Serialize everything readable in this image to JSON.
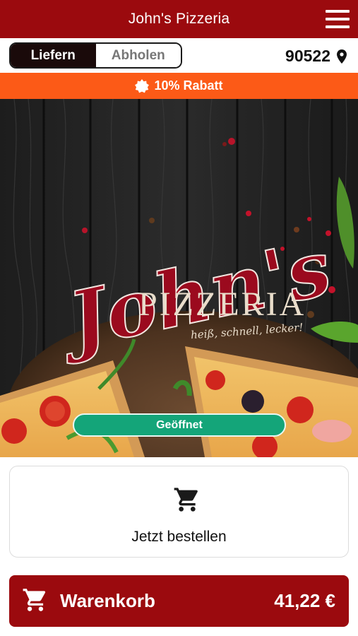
{
  "header": {
    "title": "John's Pizzeria",
    "menu_icon": "hamburger-menu-icon",
    "bg_color": "#9b0a0e"
  },
  "mode_toggle": {
    "options": [
      {
        "label": "Liefern",
        "active": true
      },
      {
        "label": "Abholen",
        "active": false
      }
    ]
  },
  "location": {
    "zip": "90522",
    "icon": "location-pin-icon"
  },
  "discount_banner": {
    "text": "10% Rabatt",
    "icon": "badge-icon",
    "bg_color": "#fc5a17"
  },
  "hero": {
    "logo_script": "John's",
    "logo_word": "PIZZERIA",
    "tagline": "heiß, schnell, lecker!",
    "status_badge": "Geöffnet",
    "status_color": "#14a579"
  },
  "order_card": {
    "label": "Jetzt bestellen",
    "icon": "cart-icon"
  },
  "basket": {
    "label": "Warenkorb",
    "total": "41,22 €",
    "icon": "cart-icon"
  }
}
